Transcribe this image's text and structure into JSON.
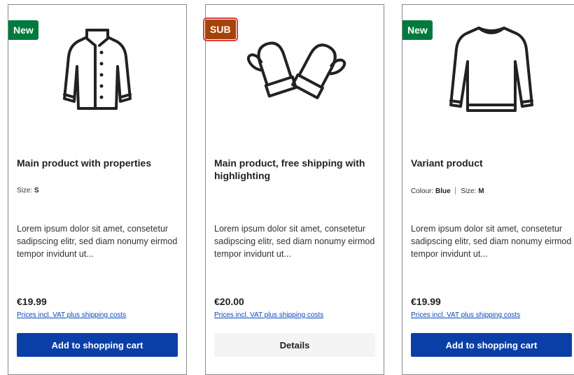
{
  "products": [
    {
      "badge": "New",
      "title": "Main product with properties",
      "props": [
        {
          "label": "Size:",
          "value": "S"
        }
      ],
      "description": "Lorem ipsum dolor sit amet, consetetur sadipscing elitr, sed diam nonumy eirmod tempor invidunt ut...",
      "price": "€19.99",
      "vat_link": "Prices incl. VAT plus shipping costs",
      "button_label": "Add to shopping cart",
      "image_icon": "jacket-icon"
    },
    {
      "badge": "SUB",
      "title": "Main product, free shipping with highlighting",
      "props": [],
      "description": "Lorem ipsum dolor sit amet, consetetur sadipscing elitr, sed diam nonumy eirmod tempor invidunt ut...",
      "price": "€20.00",
      "vat_link": "Prices incl. VAT plus shipping costs",
      "button_label": "Details",
      "image_icon": "mittens-icon"
    },
    {
      "badge": "New",
      "title": "Variant product",
      "props": [
        {
          "label": "Colour:",
          "value": "Blue"
        },
        {
          "label": "Size:",
          "value": "M"
        }
      ],
      "description": "Lorem ipsum dolor sit amet, consetetur sadipscing elitr, sed diam nonumy eirmod tempor invidunt ut...",
      "price": "€19.99",
      "vat_link": "Prices incl. VAT plus shipping costs",
      "button_label": "Add to shopping cart",
      "image_icon": "sweater-icon"
    }
  ],
  "colors": {
    "new_badge": "#007a3d",
    "sub_badge": "#a4440a",
    "primary_button": "#0a3fa8",
    "link": "#0b47b8"
  }
}
